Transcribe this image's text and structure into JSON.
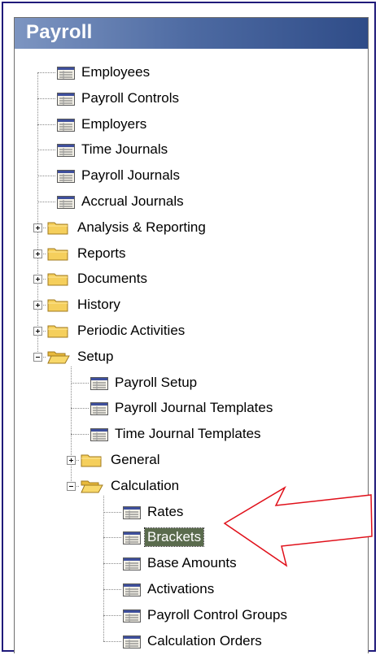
{
  "window": {
    "title": "Payroll"
  },
  "tree": {
    "items": [
      {
        "label": "Employees",
        "type": "item",
        "level": 0
      },
      {
        "label": "Payroll Controls",
        "type": "item",
        "level": 0
      },
      {
        "label": "Employers",
        "type": "item",
        "level": 0
      },
      {
        "label": "Time Journals",
        "type": "item",
        "level": 0
      },
      {
        "label": "Payroll Journals",
        "type": "item",
        "level": 0
      },
      {
        "label": "Accrual Journals",
        "type": "item",
        "level": 0
      },
      {
        "label": "Analysis & Reporting",
        "type": "folder",
        "level": 0,
        "expanded": false
      },
      {
        "label": "Reports",
        "type": "folder",
        "level": 0,
        "expanded": false
      },
      {
        "label": "Documents",
        "type": "folder",
        "level": 0,
        "expanded": false
      },
      {
        "label": "History",
        "type": "folder",
        "level": 0,
        "expanded": false
      },
      {
        "label": "Periodic Activities",
        "type": "folder",
        "level": 0,
        "expanded": false
      },
      {
        "label": "Setup",
        "type": "folder",
        "level": 0,
        "expanded": true
      },
      {
        "label": "Payroll Setup",
        "type": "item",
        "level": 1
      },
      {
        "label": "Payroll Journal Templates",
        "type": "item",
        "level": 1
      },
      {
        "label": "Time Journal Templates",
        "type": "item",
        "level": 1
      },
      {
        "label": "General",
        "type": "folder",
        "level": 1,
        "expanded": false
      },
      {
        "label": "Calculation",
        "type": "folder",
        "level": 1,
        "expanded": true
      },
      {
        "label": "Rates",
        "type": "item",
        "level": 2
      },
      {
        "label": "Brackets",
        "type": "item",
        "level": 2,
        "selected": true
      },
      {
        "label": "Base Amounts",
        "type": "item",
        "level": 2
      },
      {
        "label": "Activations",
        "type": "item",
        "level": 2
      },
      {
        "label": "Payroll Control Groups",
        "type": "item",
        "level": 2
      },
      {
        "label": "Calculation Orders",
        "type": "item",
        "level": 2
      }
    ]
  },
  "colors": {
    "frame_border": "#1f1a7a",
    "selection_bg": "#5a6b4d",
    "annotation_arrow": "#e0101a",
    "folder_fill": "#f5cf5c"
  },
  "icons": {
    "item": "table-icon",
    "folder_closed": "folder-icon",
    "folder_open": "folder-open-icon",
    "annotation": "arrow-icon"
  }
}
